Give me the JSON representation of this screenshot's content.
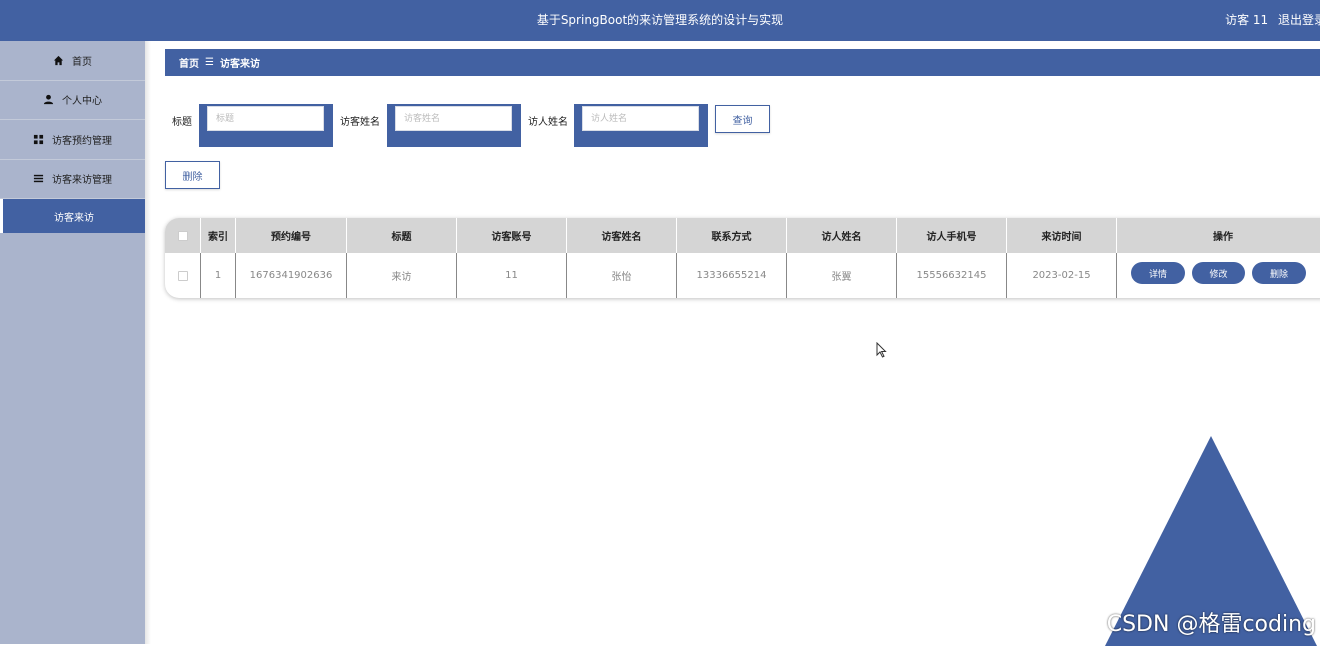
{
  "app": {
    "title": "基于SpringBoot的来访管理系统的设计与实现",
    "user_label": "访客 11",
    "logout_label": "退出登录"
  },
  "sidebar": {
    "items": [
      {
        "label": "首页",
        "icon": "home-icon"
      },
      {
        "label": "个人中心",
        "icon": "user-icon"
      },
      {
        "label": "访客预约管理",
        "icon": "grid-icon"
      },
      {
        "label": "访客来访管理",
        "icon": "list-icon"
      }
    ],
    "active_sub": "访客来访"
  },
  "breadcrumb": {
    "home": "首页",
    "separator": "☰",
    "current": "访客来访"
  },
  "search": {
    "title_label": "标题",
    "title_placeholder": "标题",
    "visitor_name_label": "访客姓名",
    "visitor_name_placeholder": "访客姓名",
    "host_name_label": "访人姓名",
    "host_name_placeholder": "访人姓名",
    "query_button": "查询"
  },
  "toolbar": {
    "delete_button": "删除"
  },
  "table": {
    "columns": [
      "索引",
      "预约编号",
      "标题",
      "访客账号",
      "访客姓名",
      "联系方式",
      "访人姓名",
      "访人手机号",
      "来访时间",
      "操作"
    ],
    "rows": [
      {
        "index": "1",
        "booking_no": "1676341902636",
        "title": "来访",
        "account": "11",
        "visitor_name": "张怡",
        "contact": "13336655214",
        "host_name": "张翼",
        "host_phone": "15556632145",
        "visit_time": "2023-02-15",
        "actions": {
          "detail": "详情",
          "edit": "修改",
          "delete": "删除"
        }
      }
    ]
  },
  "watermark": "CSDN @格雷coding",
  "colors": {
    "primary": "#4261a2",
    "sidebar": "#aab4cc",
    "table_header": "#d5d5d5"
  }
}
